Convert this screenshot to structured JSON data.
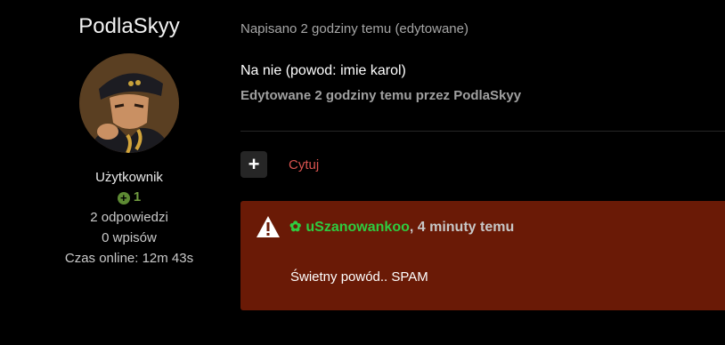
{
  "author": {
    "name": "PodlaSkyy",
    "role": "Użytkownik",
    "reputation": "1",
    "stats": {
      "replies": "2 odpowiedzi",
      "posts": "0 wpisów",
      "online": "Czas online: 12m 43s"
    }
  },
  "post": {
    "meta": "Napisano 2 godziny temu (edytowane)",
    "body": "Na nie (powod: imie karol)",
    "edited_note": "Edytowane 2 godziny temu przez PodlaSkyy"
  },
  "actions": {
    "multiquote_label": "+",
    "quote_label": "Cytuj"
  },
  "report": {
    "user": "uSzanowankoo",
    "time": ", 4 minuty temu",
    "text": "Świetny powód.. SPAM"
  },
  "colors": {
    "background": "#000000",
    "report_bg": "#6a1a06",
    "report_user": "#2ecc40",
    "quote_link": "#d9534f",
    "reputation": "#5d8a33"
  },
  "icons": {
    "reputation": "plus-circle-icon",
    "warning": "warning-triangle-icon",
    "user_gear": "gear-icon"
  }
}
